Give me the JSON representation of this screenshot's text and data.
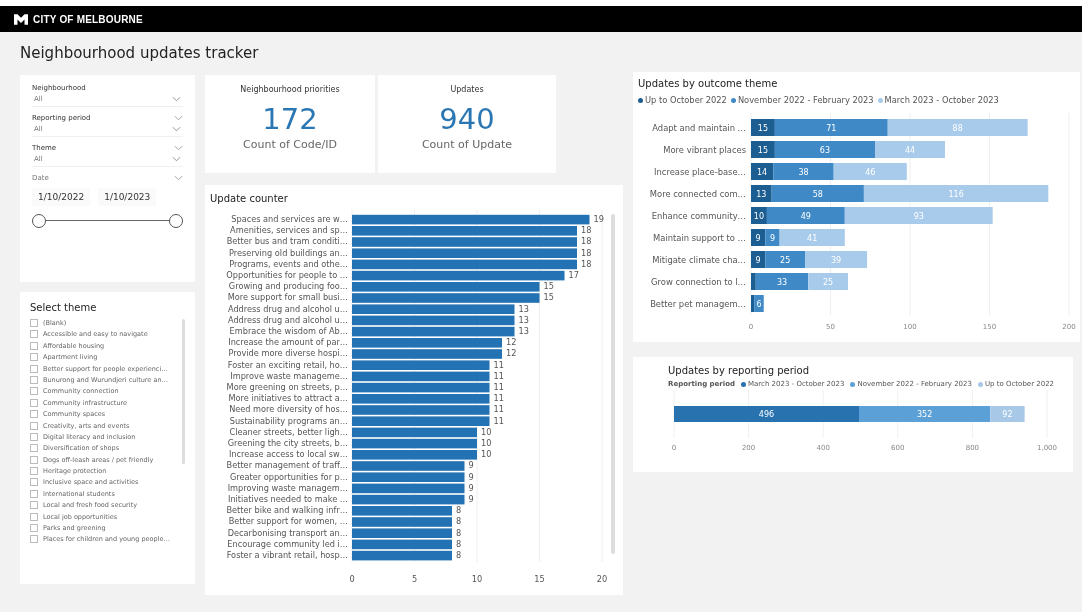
{
  "header": {
    "logo_text": "CITY OF MELBOURNE"
  },
  "title": "Neighbourhood updates tracker",
  "filters": [
    {
      "kind": "dropdown",
      "label": "Neighbourhood",
      "value": "All",
      "collapsible": false
    },
    {
      "kind": "dropdown",
      "label": "Reporting period",
      "value": "All",
      "collapsible": true
    },
    {
      "kind": "dropdown",
      "label": "Theme",
      "value": "All",
      "collapsible": true
    },
    {
      "kind": "date",
      "label": "Date",
      "from": "1/10/2022",
      "to": "1/10/2023",
      "collapsible": true,
      "handles": [
        {
          "level": 0
        },
        {
          "level": 1
        }
      ]
    }
  ],
  "kpis": [
    {
      "title": "Neighbourhood priorities",
      "value": "172",
      "caption": "Count of Code/ID"
    },
    {
      "title": "Updates",
      "value": "940",
      "caption": "Count of Update"
    }
  ],
  "theme_list": {
    "title": "Select theme",
    "items": [
      {
        "label": "(Blank)",
        "checked": false
      },
      {
        "label": "Accessible and easy to navigate",
        "checked": false
      },
      {
        "label": "Affordable housing",
        "checked": false
      },
      {
        "label": "Apartment living",
        "checked": false
      },
      {
        "label": "Better support for people experienci…",
        "checked": false
      },
      {
        "label": "Bunurong and Wurundjeri culture an…",
        "checked": false
      },
      {
        "label": "Community connection",
        "checked": false
      },
      {
        "label": "Community infrastructure",
        "checked": false
      },
      {
        "label": "Community spaces",
        "checked": false
      },
      {
        "label": "Creativity, arts and events",
        "checked": false
      },
      {
        "label": "Digital literacy and inclusion",
        "checked": false
      },
      {
        "label": "Diversification of shops",
        "checked": false
      },
      {
        "label": "Dogs off-leash areas / pet friendly",
        "checked": false
      },
      {
        "label": "Heritage protection",
        "checked": false
      },
      {
        "label": "Inclusive space and activities",
        "checked": false
      },
      {
        "label": "International students",
        "checked": false
      },
      {
        "label": "Local and fresh food security",
        "checked": false
      },
      {
        "label": "Local job opportunities",
        "checked": false
      },
      {
        "label": "Parks and greening",
        "checked": false
      },
      {
        "label": "Places for children and young people…",
        "checked": false
      }
    ]
  },
  "update_counter": {
    "title": "Update counter",
    "chart_data": {
      "type": "bar",
      "orientation": "horizontal",
      "data_labels": true,
      "grid": true,
      "xlim": [
        0,
        20
      ],
      "xticks": [
        0,
        5,
        10,
        15,
        20
      ],
      "categories": [
        "Spaces and services are w…",
        "Amenities, services and sp…",
        "Better bus and tram conditi…",
        "Preserving old buildings an…",
        "Programs, events and othe…",
        "Opportunities for people to …",
        "Growing and producing foo…",
        "More support for small busi…",
        "Address drug and alcohol u…",
        "Address drug and alcohol u…",
        "Embrace the wisdom of Ab…",
        "Increase the amount of par…",
        "Provide more diverse hospi…",
        "Foster an exciting retail, ho…",
        "Improve waste manageme…",
        "More greening on streets, p…",
        "More initiatives to attract a…",
        "Need more diversity of hos…",
        "Sustainability programs an…",
        "Cleaner streets, better ligh…",
        "Greening the city streets, b…",
        "Increase access to local sw…",
        "Better management of traff…",
        "Greater opportunities for p…",
        "Improving waste managem…",
        "Initiatives needed to make …",
        "Better bike and walking infr…",
        "Better support for women, …",
        "Decarbonising transport an…",
        "Encourage community led i…",
        "Foster a vibrant retail, hosp…"
      ],
      "values": [
        19,
        18,
        18,
        18,
        18,
        17,
        15,
        15,
        13,
        13,
        13,
        12,
        12,
        11,
        11,
        11,
        11,
        11,
        11,
        10,
        10,
        10,
        9,
        9,
        9,
        9,
        8,
        8,
        8,
        8,
        8
      ]
    }
  },
  "outcome_theme": {
    "title": "Updates by outcome theme",
    "chart_data": {
      "type": "bar",
      "orientation": "horizontal",
      "stacked": true,
      "grid": true,
      "xlim": [
        0,
        200
      ],
      "xticks": [
        0,
        50,
        100,
        150,
        200
      ],
      "categories": [
        "Adapt and maintain …",
        "More vibrant places",
        "Increase place-base…",
        "More connected com…",
        "Enhance community…",
        "Maintain support to …",
        "Mitigate climate cha…",
        "Grow connection to l…",
        "Better pet managem…"
      ],
      "series": [
        {
          "name": "Up to October 2022",
          "color": "#1c5d92",
          "values": [
            15,
            15,
            14,
            13,
            10,
            9,
            9,
            3,
            2
          ]
        },
        {
          "name": "November 2022 - February 2023",
          "color": "#3f8ac6",
          "values": [
            71,
            63,
            38,
            58,
            49,
            9,
            25,
            33,
            6
          ]
        },
        {
          "name": "March 2023 - October 2023",
          "color": "#a9cbeb",
          "values": [
            88,
            44,
            46,
            116,
            93,
            41,
            39,
            25,
            null
          ]
        }
      ],
      "value_labels": [
        [
          "15",
          "15",
          "14",
          "13",
          "10",
          "9",
          "9",
          null,
          null
        ],
        [
          "71",
          "63",
          "38",
          "58",
          "49",
          "9",
          "25",
          "33",
          "6"
        ],
        [
          "88",
          "44",
          "46",
          "116",
          "93",
          "41",
          "39",
          "25",
          null
        ]
      ]
    }
  },
  "reporting_period": {
    "title": "Updates by reporting period",
    "legend_title": "Reporting period",
    "chart_data": {
      "type": "bar",
      "orientation": "horizontal",
      "stacked": true,
      "data_labels": true,
      "grid": true,
      "xlim": [
        0,
        1000
      ],
      "xticks": [
        0,
        200,
        400,
        600,
        800,
        {
          "value": 1000,
          "label": "1,000"
        }
      ],
      "series": [
        {
          "name": "March 2023 - October 2023",
          "color": "#2872b0",
          "values": [
            496
          ]
        },
        {
          "name": "November 2022 - February 2023",
          "color": "#5ba0d6",
          "values": [
            352
          ]
        },
        {
          "name": "Up to October 2022",
          "color": "#a8c8e8",
          "values": [
            92
          ]
        }
      ]
    }
  }
}
